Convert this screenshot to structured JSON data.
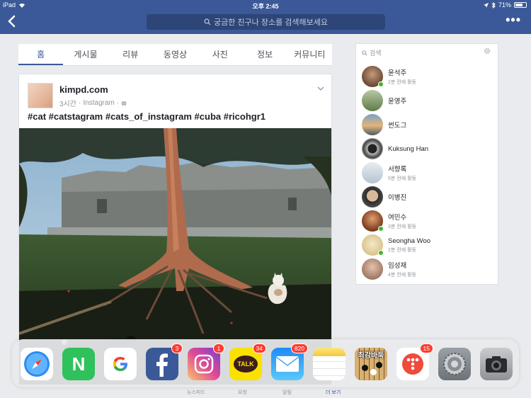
{
  "status_bar": {
    "device": "iPad",
    "time": "오후 2:45",
    "battery": "71%",
    "battery_level": 0.71
  },
  "nav": {
    "search_placeholder": "궁금한 친구나 장소를 검색해보세요",
    "more_label": "•••"
  },
  "tabs": [
    {
      "label": "홈",
      "active": true
    },
    {
      "label": "게시물"
    },
    {
      "label": "리뷰"
    },
    {
      "label": "동영상"
    },
    {
      "label": "사진"
    },
    {
      "label": "정보"
    },
    {
      "label": "커뮤니티"
    }
  ],
  "post": {
    "author": "kimpd.com",
    "time": "3시간",
    "source": "Instagram",
    "text": "#cat #catstagram #cats_of_instagram #cuba #ricohgr1"
  },
  "friends_panel": {
    "search_placeholder": "검색",
    "friends": [
      {
        "name": "윤석주",
        "status": "2분 전에 활동",
        "online": true
      },
      {
        "name": "윤영주",
        "status": "",
        "online": false
      },
      {
        "name": "썬도그",
        "status": "",
        "online": false
      },
      {
        "name": "Kuksung Han",
        "status": "",
        "online": false
      },
      {
        "name": "서향록",
        "status": "5분 전에 활동",
        "online": false
      },
      {
        "name": "이병진",
        "status": "",
        "online": false
      },
      {
        "name": "여민수",
        "status": "3분 전에 활동",
        "online": true
      },
      {
        "name": "Seongha Woo",
        "status": "2분 전에 활동",
        "online": true
      },
      {
        "name": "임성재",
        "status": "4분 전에 활동",
        "online": false
      }
    ]
  },
  "dock": {
    "apps": [
      {
        "name": "Safari",
        "badge": ""
      },
      {
        "name": "Naver",
        "badge": ""
      },
      {
        "name": "Google",
        "badge": ""
      },
      {
        "name": "Facebook",
        "badge": "3"
      },
      {
        "name": "Instagram",
        "badge": "1"
      },
      {
        "name": "KakaoTalk",
        "badge": "34"
      },
      {
        "name": "Mail",
        "badge": "820"
      },
      {
        "name": "Notes",
        "badge": ""
      },
      {
        "name": "최강바둑",
        "badge": ""
      },
      {
        "name": "Tmap",
        "badge": "15"
      },
      {
        "name": "Settings",
        "badge": ""
      },
      {
        "name": "Camera",
        "badge": ""
      }
    ],
    "baduk_label": "최강바둑",
    "kakao_label": "TALK",
    "naver_label": "N"
  },
  "bottom_tabs": [
    {
      "label": "뉴스피드"
    },
    {
      "label": "요청"
    },
    {
      "label": "알림"
    },
    {
      "label": "더 보기",
      "active": true
    }
  ],
  "colors": {
    "facebook_blue": "#3b5998",
    "online_green": "#42b72a",
    "badge_red": "#ff3b30"
  }
}
